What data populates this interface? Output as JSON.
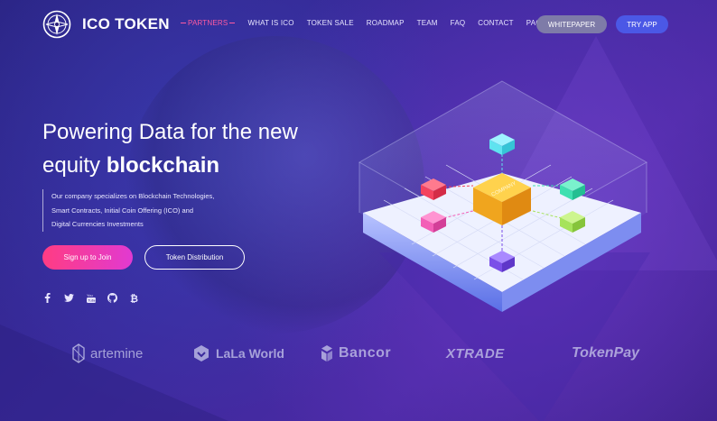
{
  "brand": {
    "name": "ICO TOKEN",
    "logo_icon": "compass-logo-icon"
  },
  "nav": {
    "items": [
      {
        "label": "PARTNERS",
        "active": true
      },
      {
        "label": "WHAT IS ICO"
      },
      {
        "label": "TOKEN SALE"
      },
      {
        "label": "ROADMAP"
      },
      {
        "label": "TEAM"
      },
      {
        "label": "FAQ"
      },
      {
        "label": "CONTACT"
      },
      {
        "label": "PAGES"
      }
    ],
    "whitepaper_label": "WHITEPAPER",
    "tryapp_label": "TRY APP"
  },
  "hero": {
    "title_line1": "Powering Data for the new",
    "title_line2_prefix": "equity ",
    "title_line2_bold": "blockchain",
    "desc_line1": "Our company specializes on Blockchain Technologies,",
    "desc_line2": "Smart Contracts, Initial Coin Offering (ICO) and",
    "desc_line3": "Digital Currencies Investments",
    "join_label": "Sign up to Join",
    "distribution_label": "Token Distribution"
  },
  "socials": [
    {
      "icon": "facebook-icon"
    },
    {
      "icon": "twitter-icon"
    },
    {
      "icon": "youtube-icon"
    },
    {
      "icon": "github-icon"
    },
    {
      "icon": "bitcoin-icon"
    }
  ],
  "partners": [
    {
      "label": "artemine",
      "icon": "artemine-logo-icon"
    },
    {
      "label": "LaLa World",
      "icon": "lala-world-logo-icon"
    },
    {
      "label": "Bancor",
      "icon": "bancor-logo-icon"
    },
    {
      "label": "XTRADE"
    },
    {
      "label": "TokenPay"
    }
  ],
  "illustration": {
    "center_cube_label": "COMPANY"
  },
  "colors": {
    "background": "#2a1f79",
    "accent_pink": "#ff3c83",
    "accent_blue": "#4b58e6",
    "whitepaper_grey": "#7e7ba8",
    "cube_gold": "#f7b733",
    "cube_cyan": "#5fe3f0",
    "cube_red": "#f4435f",
    "cube_green": "#3fe0b0",
    "cube_pink": "#f35fb7",
    "cube_lime": "#a6e35b",
    "cube_purple": "#7b4fe8"
  }
}
